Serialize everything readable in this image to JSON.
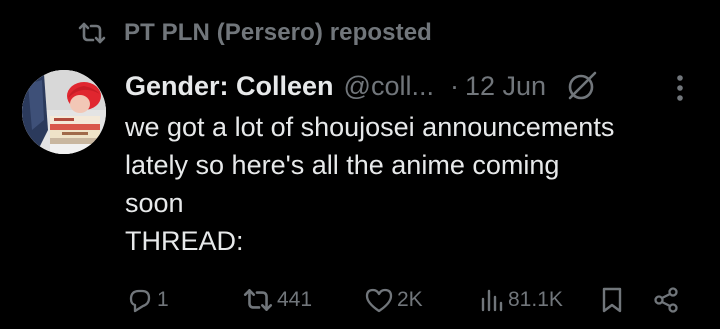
{
  "repost_banner": {
    "text": "PT PLN (Persero) reposted",
    "icon": "repost-icon"
  },
  "tweet": {
    "author": {
      "display_name": "Gender: Colleen",
      "handle": "@coll...",
      "avatar": "avatar"
    },
    "separator": "·",
    "date": "12 Jun",
    "badge_icon": "grok-icon",
    "more_icon": "more-vertical-icon",
    "text_lines": [
      "we got a lot of shoujosei announcements",
      "lately so here's all the anime coming",
      "soon",
      "THREAD:"
    ],
    "actions": {
      "replies": "1",
      "reposts": "441",
      "likes": "2K",
      "views": "81.1K"
    }
  },
  "colors": {
    "background": "#000000",
    "primary_text": "#e7e9ea",
    "secondary_text": "#71767b"
  }
}
